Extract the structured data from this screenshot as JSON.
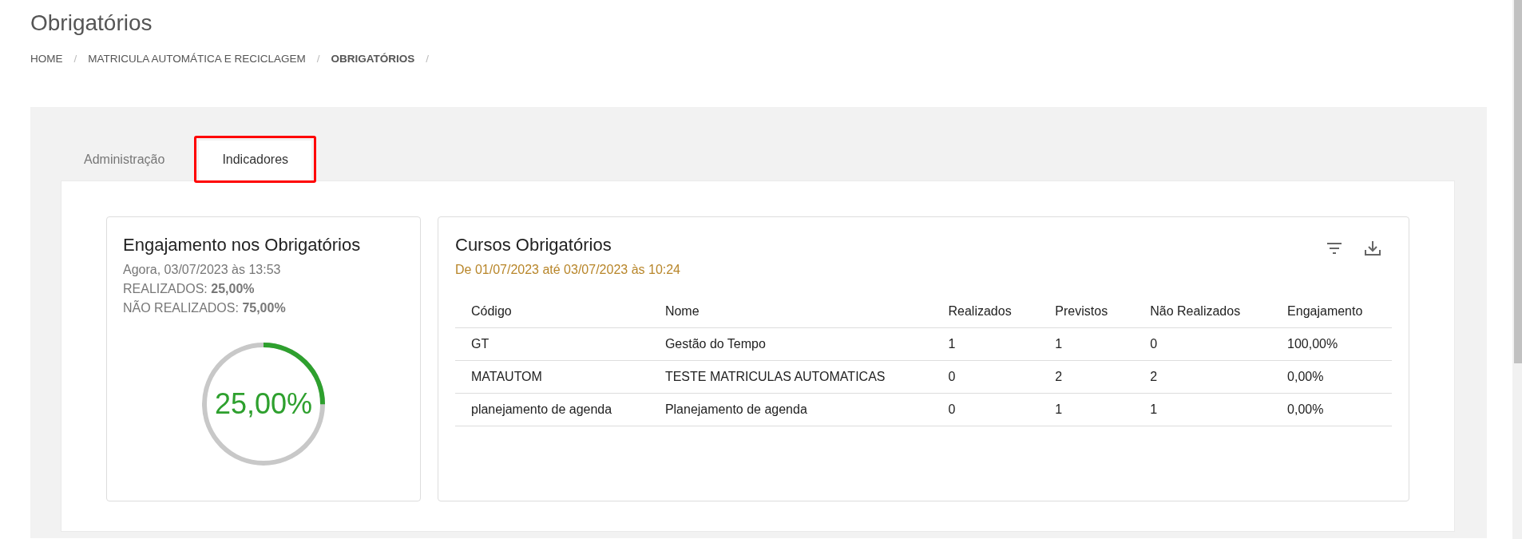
{
  "page_title": "Obrigatórios",
  "breadcrumb_separator": "/",
  "breadcrumb": [
    {
      "label": "HOME",
      "current": false
    },
    {
      "label": "MATRICULA AUTOMÁTICA E RECICLAGEM",
      "current": false
    },
    {
      "label": "OBRIGATÓRIOS",
      "current": true
    }
  ],
  "tabs": [
    {
      "label": "Administração",
      "selected": false,
      "highlighted": false
    },
    {
      "label": "Indicadores",
      "selected": true,
      "highlighted": true
    }
  ],
  "engagement_card": {
    "title": "Engajamento nos Obrigatórios",
    "timestamp": "Agora, 03/07/2023 às 13:53",
    "stats": [
      "REALIZADOS: **25,00%**",
      "NÃO REALIZADOS: **75,00%**"
    ],
    "gauge": {
      "level": 0.25,
      "label": "25,00%"
    }
  },
  "courses_card": {
    "title": "Cursos Obrigatórios",
    "period": "De 01/07/2023 até 03/07/2023 às 10:24",
    "table": {
      "columns": [
        "Código",
        "Nome",
        "Realizados",
        "Previstos",
        "Não Realizados",
        "Engajamento"
      ],
      "rows": [
        [
          "GT",
          "Gestão do Tempo",
          "1",
          "1",
          "0",
          "100,00%"
        ],
        [
          "MATAUTOM",
          "TESTE MATRICULAS AUTOMATICAS",
          "0",
          "2",
          "2",
          "0,00%"
        ],
        [
          "planejamento de agenda",
          "Planejamento de agenda",
          "0",
          "1",
          "1",
          "0,00%"
        ]
      ]
    }
  }
}
